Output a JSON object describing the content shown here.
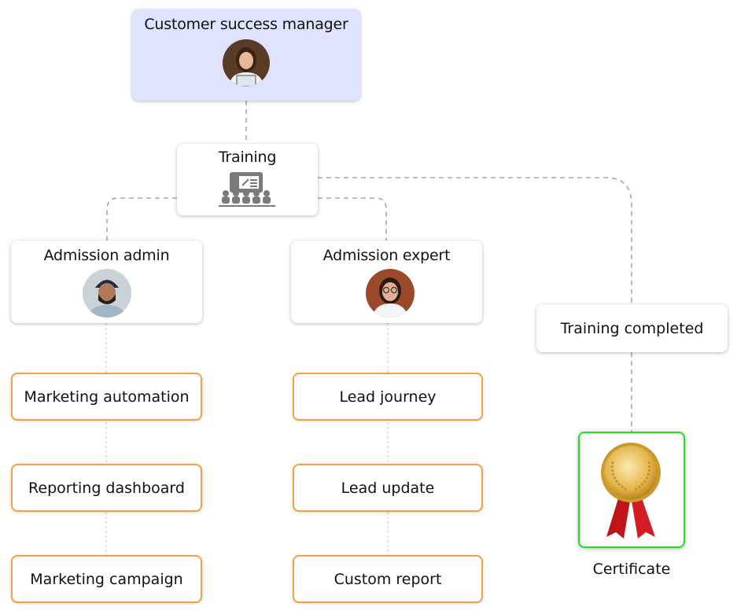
{
  "nodes": {
    "customer_success_manager": {
      "label": "Customer success manager",
      "avatar": "woman-with-clipboard-photo"
    },
    "training": {
      "label": "Training",
      "icon": "classroom-presentation-icon"
    },
    "admission_admin": {
      "label": "Admission admin",
      "avatar": "man-with-turban-photo"
    },
    "admission_expert": {
      "label": "Admission expert",
      "avatar": "woman-with-glasses-photo"
    },
    "training_completed": {
      "label": "Training completed"
    },
    "certificate": {
      "label": "Certificate",
      "icon": "gold-medal-ribbon-icon"
    }
  },
  "admin_tasks": [
    "Marketing automation",
    "Reporting dashboard",
    "Marketing campaign"
  ],
  "expert_tasks": [
    "Lead journey",
    "Lead update",
    "Custom report"
  ],
  "colors": {
    "manager_bg": "#dfe3fd",
    "task_border": "#f5a044",
    "certificate_border": "#22e022",
    "connector": "#a8a8a8"
  }
}
